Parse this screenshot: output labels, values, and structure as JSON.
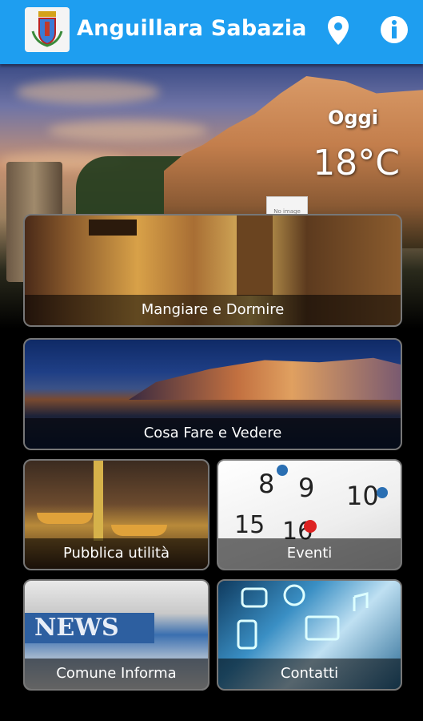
{
  "app": {
    "title": "Anguillara Sabazia",
    "logo_icon": "town-crest-icon",
    "location_icon": "location-pin-icon",
    "info_icon": "info-icon"
  },
  "hero": {
    "placeholder_text": "No image"
  },
  "weather": {
    "day_label": "Oggi",
    "temperature": "18°C"
  },
  "menu": [
    {
      "label": "Mangiare e Dormire"
    },
    {
      "label": "Cosa Fare e Vedere"
    },
    {
      "label": "Pubblica utilità"
    },
    {
      "label": "Eventi"
    },
    {
      "label": "Comune Informa"
    },
    {
      "label": "Contatti"
    }
  ],
  "colors": {
    "appbar": "#1e9ef0",
    "text": "#ffffff",
    "background": "#000000"
  }
}
